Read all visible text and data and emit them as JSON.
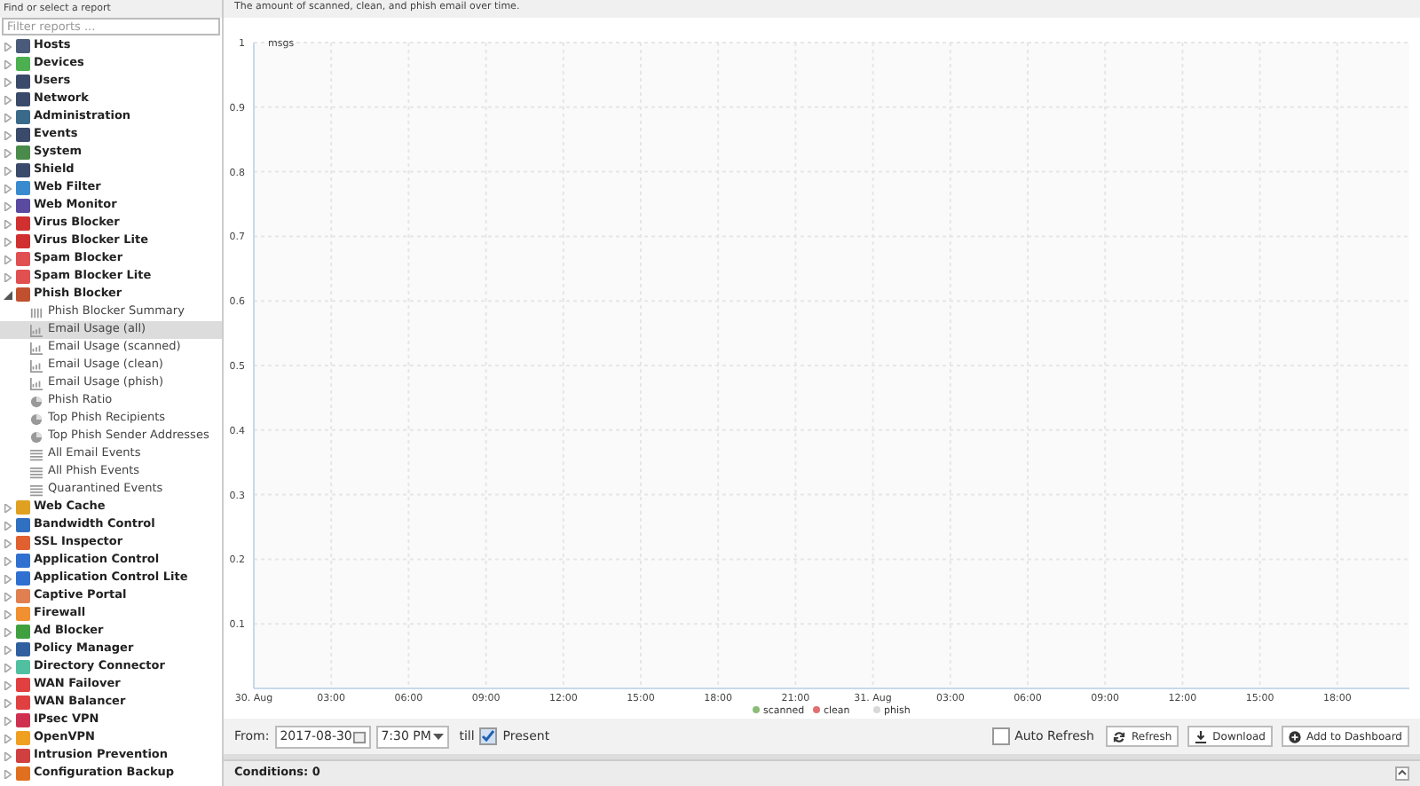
{
  "sidebar": {
    "title": "Find or select a report",
    "filter": {
      "placeholder": "Filter reports ..."
    },
    "items": [
      {
        "label": "Hosts",
        "expanded": false,
        "color": "#4a5a7a"
      },
      {
        "label": "Devices",
        "expanded": false,
        "color": "#4caf50"
      },
      {
        "label": "Users",
        "expanded": false,
        "color": "#3a4a6a"
      },
      {
        "label": "Network",
        "expanded": false,
        "color": "#3a4a6a"
      },
      {
        "label": "Administration",
        "expanded": false,
        "color": "#3a6a8a"
      },
      {
        "label": "Events",
        "expanded": false,
        "color": "#3a4a6a"
      },
      {
        "label": "System",
        "expanded": false,
        "color": "#4a8a4a"
      },
      {
        "label": "Shield",
        "expanded": false,
        "color": "#3a4a6a"
      },
      {
        "label": "Web Filter",
        "expanded": false,
        "color": "#3a8ad0"
      },
      {
        "label": "Web Monitor",
        "expanded": false,
        "color": "#5a4aa0"
      },
      {
        "label": "Virus Blocker",
        "expanded": false,
        "color": "#d03030"
      },
      {
        "label": "Virus Blocker Lite",
        "expanded": false,
        "color": "#d03030"
      },
      {
        "label": "Spam Blocker",
        "expanded": false,
        "color": "#e05050"
      },
      {
        "label": "Spam Blocker Lite",
        "expanded": false,
        "color": "#e05050"
      },
      {
        "label": "Phish Blocker",
        "expanded": true,
        "color": "#c05030",
        "children": [
          {
            "label": "Phish Blocker Summary",
            "kind": "text",
            "selected": false
          },
          {
            "label": "Email Usage (all)",
            "kind": "chart",
            "selected": true
          },
          {
            "label": "Email Usage (scanned)",
            "kind": "chart",
            "selected": false
          },
          {
            "label": "Email Usage (clean)",
            "kind": "chart",
            "selected": false
          },
          {
            "label": "Email Usage (phish)",
            "kind": "chart",
            "selected": false
          },
          {
            "label": "Phish Ratio",
            "kind": "pie",
            "selected": false
          },
          {
            "label": "Top Phish Recipients",
            "kind": "pie",
            "selected": false
          },
          {
            "label": "Top Phish Sender Addresses",
            "kind": "pie",
            "selected": false
          },
          {
            "label": "All Email Events",
            "kind": "list",
            "selected": false
          },
          {
            "label": "All Phish Events",
            "kind": "list",
            "selected": false
          },
          {
            "label": "Quarantined Events",
            "kind": "list",
            "selected": false
          }
        ]
      },
      {
        "label": "Web Cache",
        "expanded": false,
        "color": "#e0a020"
      },
      {
        "label": "Bandwidth Control",
        "expanded": false,
        "color": "#3070c0"
      },
      {
        "label": "SSL Inspector",
        "expanded": false,
        "color": "#e06030"
      },
      {
        "label": "Application Control",
        "expanded": false,
        "color": "#3070d0"
      },
      {
        "label": "Application Control Lite",
        "expanded": false,
        "color": "#3070d0"
      },
      {
        "label": "Captive Portal",
        "expanded": false,
        "color": "#e08050"
      },
      {
        "label": "Firewall",
        "expanded": false,
        "color": "#f09030"
      },
      {
        "label": "Ad Blocker",
        "expanded": false,
        "color": "#40a040"
      },
      {
        "label": "Policy Manager",
        "expanded": false,
        "color": "#3060a0"
      },
      {
        "label": "Directory Connector",
        "expanded": false,
        "color": "#50c0a0"
      },
      {
        "label": "WAN Failover",
        "expanded": false,
        "color": "#e04040"
      },
      {
        "label": "WAN Balancer",
        "expanded": false,
        "color": "#e04040"
      },
      {
        "label": "IPsec VPN",
        "expanded": false,
        "color": "#d03050"
      },
      {
        "label": "OpenVPN",
        "expanded": false,
        "color": "#f0a020"
      },
      {
        "label": "Intrusion Prevention",
        "expanded": false,
        "color": "#d04040"
      },
      {
        "label": "Configuration Backup",
        "expanded": false,
        "color": "#e07020"
      }
    ]
  },
  "report": {
    "description": "The amount of scanned, clean, and phish email over time.",
    "chart_data": {
      "type": "line",
      "ylabel": "msgs",
      "ylim": [
        0,
        1
      ],
      "yticks": [
        0.1,
        0.2,
        0.3,
        0.4,
        0.5,
        0.6,
        0.7,
        0.8,
        0.9,
        1
      ],
      "grid": true,
      "categories": [
        "30. Aug",
        "03:00",
        "06:00",
        "09:00",
        "12:00",
        "15:00",
        "18:00",
        "21:00",
        "31. Aug",
        "03:00",
        "06:00",
        "09:00",
        "12:00",
        "15:00",
        "18:00"
      ],
      "series": [
        {
          "name": "scanned",
          "color": "#8bbc78",
          "values": [
            null,
            null,
            null,
            null,
            null,
            null,
            null,
            null,
            null,
            null,
            null,
            null,
            null,
            null,
            null
          ]
        },
        {
          "name": "clean",
          "color": "#e07070",
          "values": [
            null,
            null,
            null,
            null,
            null,
            null,
            null,
            null,
            null,
            null,
            null,
            null,
            null,
            null,
            null
          ]
        },
        {
          "name": "phish",
          "color": "#d8d8d8",
          "values": [
            null,
            null,
            null,
            null,
            null,
            null,
            null,
            null,
            null,
            null,
            null,
            null,
            null,
            null,
            null
          ]
        }
      ]
    },
    "toolbar": {
      "from_label": "From:",
      "date": "2017-08-30",
      "time": "7:30 PM",
      "till_label": "till",
      "present": {
        "label": "Present",
        "checked": true
      },
      "auto_refresh": {
        "label": "Auto Refresh",
        "checked": false
      },
      "buttons": [
        {
          "label": "Refresh",
          "kind": "refresh"
        },
        {
          "label": "Download",
          "kind": "download"
        },
        {
          "label": "Add to Dashboard",
          "kind": "add"
        }
      ]
    }
  },
  "conditions": {
    "label": "Conditions: 0"
  }
}
